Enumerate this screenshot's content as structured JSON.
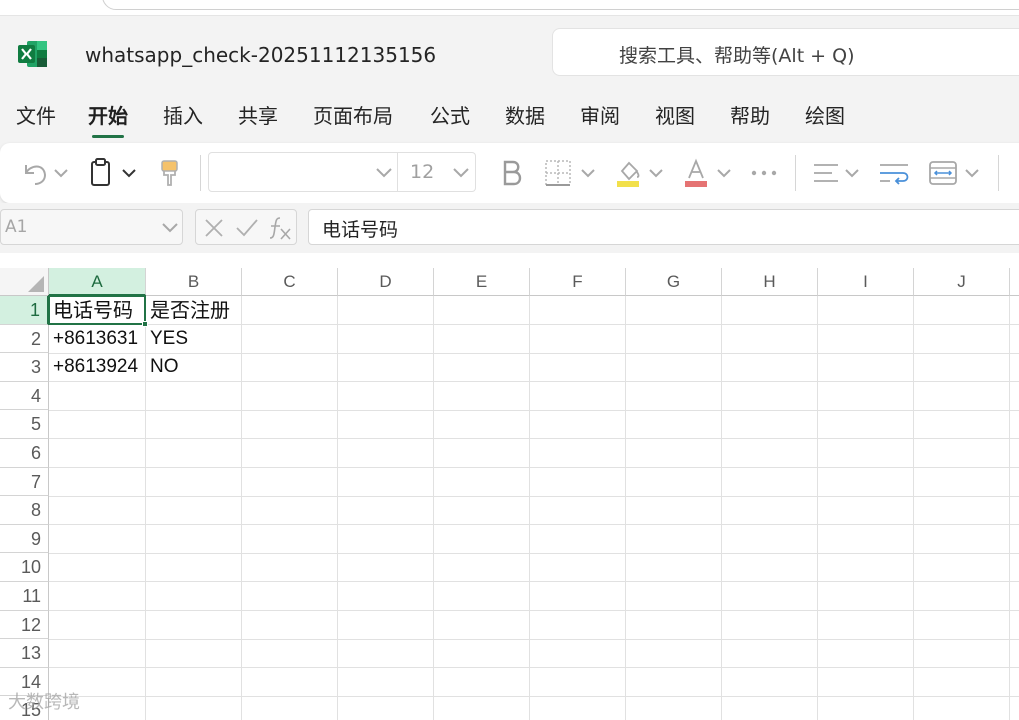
{
  "app": {
    "title": "whatsapp_check-20251112135156",
    "search_placeholder": "搜索工具、帮助等(Alt + Q)"
  },
  "tabs": [
    {
      "label": "文件"
    },
    {
      "label": "开始",
      "active": true
    },
    {
      "label": "插入"
    },
    {
      "label": "共享"
    },
    {
      "label": "页面布局"
    },
    {
      "label": "公式"
    },
    {
      "label": "数据"
    },
    {
      "label": "审阅"
    },
    {
      "label": "视图"
    },
    {
      "label": "帮助"
    },
    {
      "label": "绘图"
    }
  ],
  "ribbon": {
    "font_name": "",
    "font_size": "12",
    "icons": [
      "undo-icon",
      "clipboard-icon",
      "format-painter-icon",
      "bold-icon",
      "borders-icon",
      "fill-color-icon",
      "font-color-icon",
      "more-icon",
      "align-icon",
      "wrap-text-icon",
      "merge-icon"
    ],
    "fill_color": "#f2e04b",
    "font_color": "#e57373"
  },
  "formula_bar": {
    "name_box": "A1",
    "content": "电话号码"
  },
  "sheet": {
    "columns": [
      "A",
      "B",
      "C",
      "D",
      "E",
      "F",
      "G",
      "H",
      "I",
      "J"
    ],
    "rows": [
      "1",
      "2",
      "3",
      "4",
      "5",
      "6",
      "7",
      "8",
      "9",
      "10",
      "11",
      "12",
      "13",
      "14",
      "15"
    ],
    "selected_cell": "A1",
    "cells": {
      "A1": "电话号码",
      "B1": "是否注册",
      "A2": "+8613631",
      "B2": "YES",
      "A3": "+8613924",
      "B3": "NO"
    },
    "accent_color": "#217346"
  },
  "watermark": "大数跨境"
}
